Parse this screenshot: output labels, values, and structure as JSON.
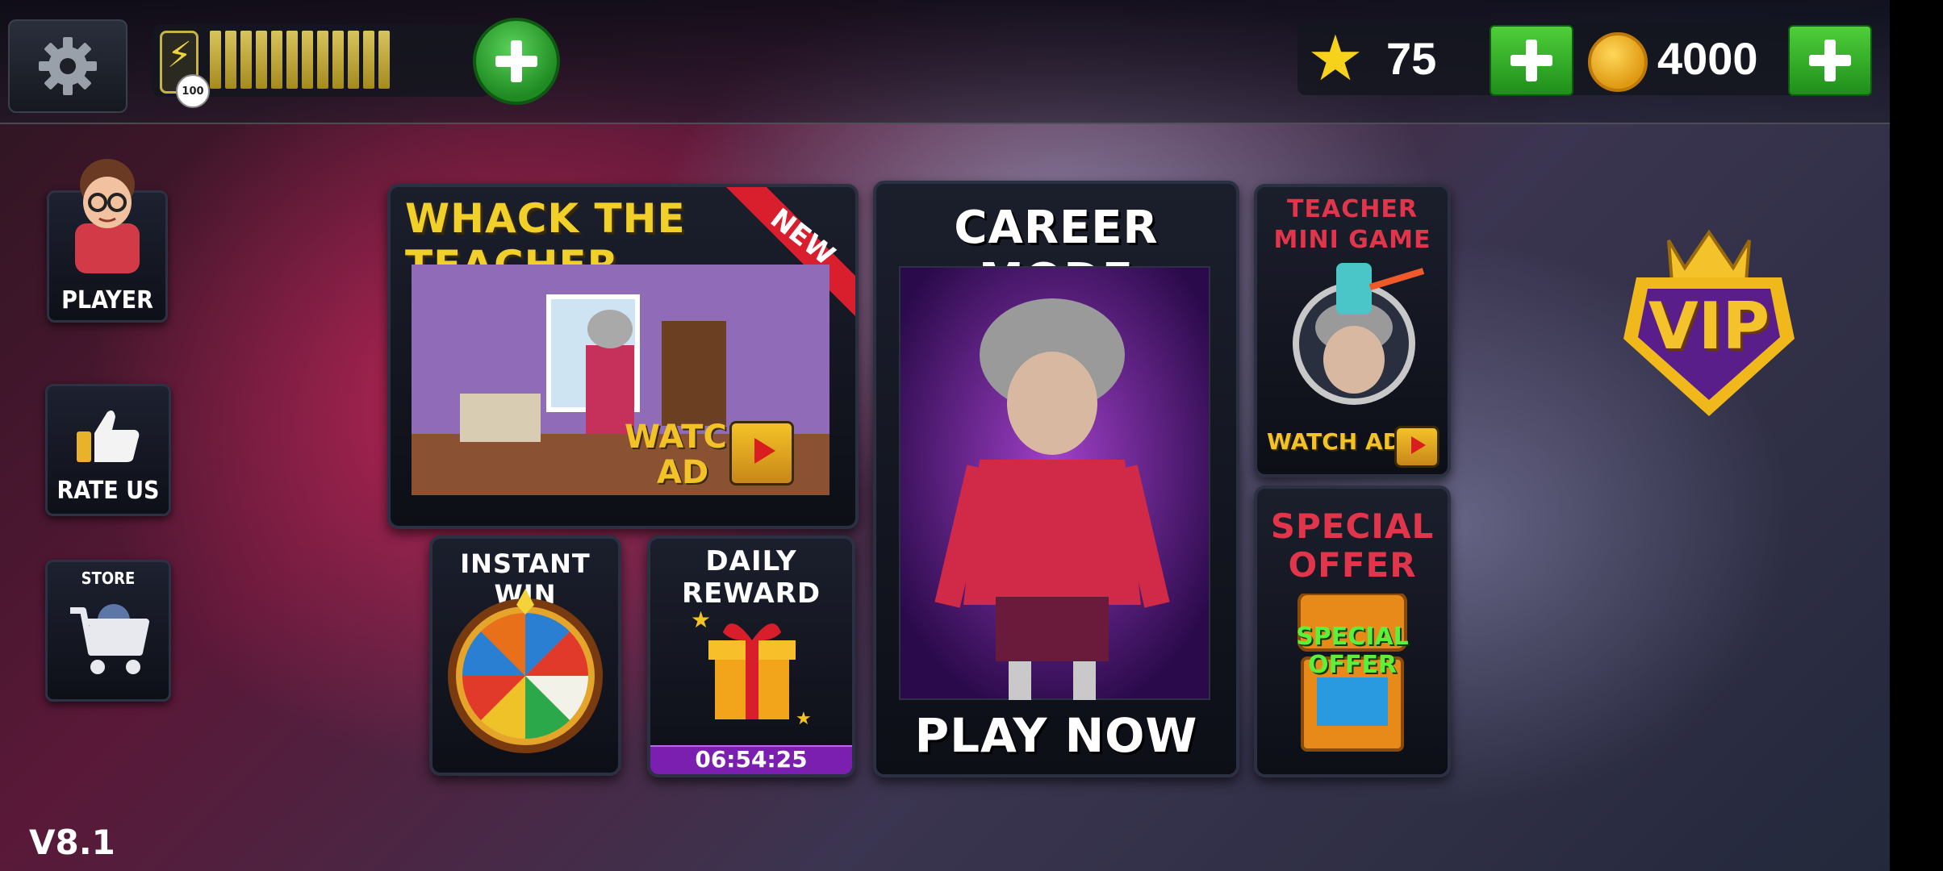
{
  "topbar": {
    "energy": {
      "count": "100",
      "bars_filled": 12,
      "bars_total": 12
    },
    "stars": {
      "value": "75"
    },
    "coins": {
      "value": "4000"
    }
  },
  "sidebar": {
    "player": {
      "label": "PLAYER"
    },
    "rate": {
      "label": "RATE US"
    },
    "store": {
      "label": "STORE"
    }
  },
  "cards": {
    "whack": {
      "title": "WHACK THE TEACHER",
      "ribbon": "NEW",
      "watch_line1": "WATCH",
      "watch_line2": "AD"
    },
    "instant": {
      "title": "INSTANT WIN"
    },
    "daily": {
      "title": "DAILY REWARD",
      "timer": "06:54:25"
    },
    "career": {
      "title": "CAREER MODE",
      "action": "PLAY NOW"
    },
    "mini": {
      "title_line1": "TEACHER",
      "title_line2": "MINI GAME",
      "watch": "WATCH AD"
    },
    "special": {
      "title_line1": "SPECIAL",
      "title_line2": "OFFER",
      "label": "SPECIAL OFFER"
    }
  },
  "vip": {
    "label": "VIP"
  },
  "version": "V8.1",
  "colors": {
    "accent_yellow": "#f2c227",
    "accent_red": "#e0354a",
    "green": "#2fb52a",
    "timer_bar": "#7a1fb0"
  }
}
